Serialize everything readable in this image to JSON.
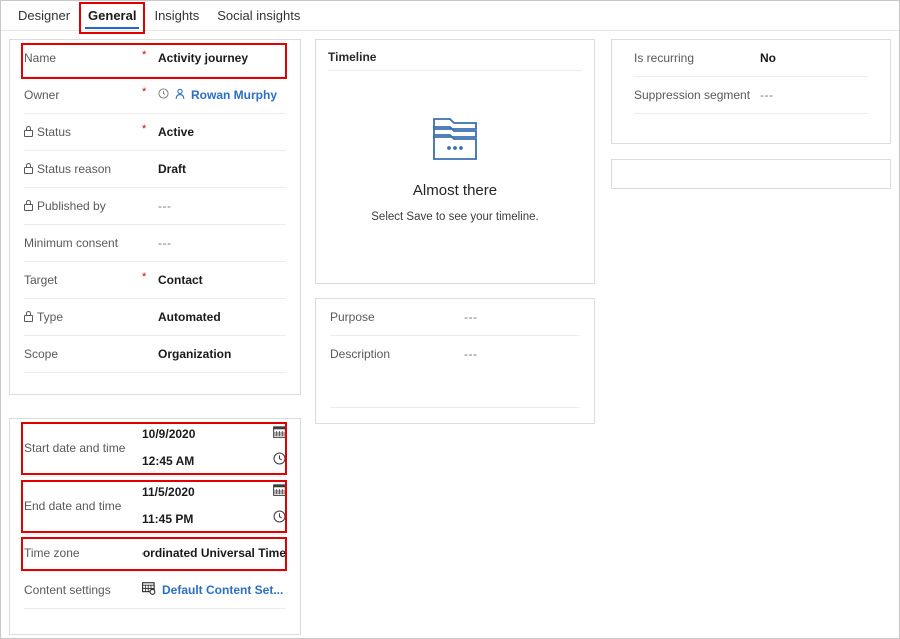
{
  "tabs": [
    {
      "label": "Designer",
      "active": false
    },
    {
      "label": "General",
      "active": true
    },
    {
      "label": "Insights",
      "active": false
    },
    {
      "label": "Social insights",
      "active": false
    }
  ],
  "left_panel": {
    "rows": [
      {
        "label": "Name",
        "required": true,
        "locked": false,
        "value": "Activity journey",
        "style": "bold"
      },
      {
        "label": "Owner",
        "required": true,
        "locked": false,
        "value": "Rowan Murphy",
        "style": "link",
        "icons": [
          "recent-icon",
          "person-icon"
        ]
      },
      {
        "label": "Status",
        "required": true,
        "locked": true,
        "value": "Active",
        "style": "bold"
      },
      {
        "label": "Status reason",
        "required": false,
        "locked": true,
        "value": "Draft",
        "style": "bold"
      },
      {
        "label": "Published by",
        "required": false,
        "locked": true,
        "value": "---",
        "style": "dim"
      },
      {
        "label": "Minimum consent",
        "required": false,
        "locked": false,
        "value": "---",
        "style": "dim"
      },
      {
        "label": "Target",
        "required": true,
        "locked": false,
        "value": "Contact",
        "style": "bold"
      },
      {
        "label": "Type",
        "required": false,
        "locked": true,
        "value": "Automated",
        "style": "bold"
      },
      {
        "label": "Scope",
        "required": false,
        "locked": false,
        "value": "Organization",
        "style": "bold"
      }
    ]
  },
  "schedule_panel": {
    "start": {
      "label": "Start date and time",
      "date": "10/9/2020",
      "time": "12:45 AM"
    },
    "end": {
      "label": "End date and time",
      "date": "11/5/2020",
      "time": "11:45 PM"
    },
    "timezone": {
      "label": "Time zone",
      "value": "(GMT) Coordinated Universal Time"
    },
    "content_settings": {
      "label": "Content settings",
      "value": "Default Content Set..."
    }
  },
  "timeline_panel": {
    "title": "Timeline",
    "empty_title": "Almost there",
    "empty_subtitle": "Select Save to see your timeline."
  },
  "purpose_panel": {
    "rows": [
      {
        "label": "Purpose",
        "value": "---"
      },
      {
        "label": "Description",
        "value": "---"
      }
    ]
  },
  "recurring_panel": {
    "rows": [
      {
        "label": "Is recurring",
        "value": "No",
        "style": "bold"
      },
      {
        "label": "Suppression segment",
        "value": "---",
        "style": "dim"
      }
    ]
  },
  "colors": {
    "highlight": "#e00000",
    "accent": "#2266cc",
    "link": "#2b6fc2",
    "border": "#dcdcdc",
    "divider": "#ededed",
    "label": "#595959",
    "required": "#d40000"
  }
}
